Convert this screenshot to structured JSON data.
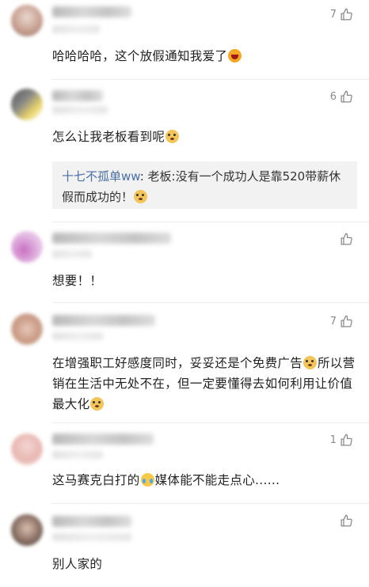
{
  "comments": [
    {
      "likes": "7",
      "text": "哈哈哈哈，这个放假通知我爱了",
      "emoji": "laughing-emoji"
    },
    {
      "likes": "6",
      "text": "怎么让我老板看到呢",
      "emoji": "doge-emoji",
      "reply": {
        "author": "十七不孤单ww",
        "text": ": 老板:没有一个成功人是靠520带薪休假而成功的！",
        "emoji": "doge-emoji"
      }
    },
    {
      "likes": "",
      "text": "想要！！"
    },
    {
      "likes": "7",
      "text_part1": "在增强职工好感度同时，妥妥还是个免费广告",
      "text_part2": "所以营销在生活中无处不在，但一定要懂得去如何利用让价值最大化",
      "emoji": "doge-emoji"
    },
    {
      "likes": "1",
      "text_part1": "这马赛克白打的",
      "text_part2": "媒体能不能走点心......",
      "emoji": "crying-laughing-emoji"
    },
    {
      "likes": "",
      "text": "别人家的"
    }
  ],
  "colors": {
    "reply_author": "#4a6fa5",
    "like_icon": "#8a8a8a",
    "reply_bg": "#f2f2f2"
  },
  "icons": {
    "like": "thumbs-up-icon"
  }
}
